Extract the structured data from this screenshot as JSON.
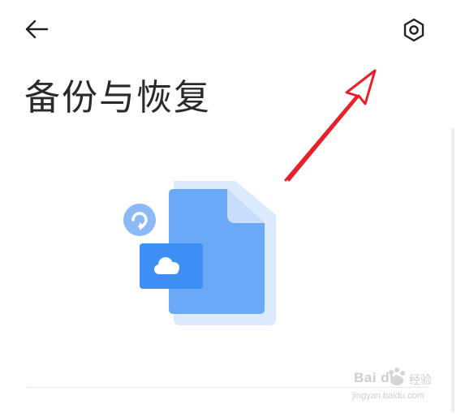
{
  "header": {
    "back_icon": "arrow-left-icon",
    "settings_icon": "gear-hexagon-icon",
    "title": "备份与恢复"
  },
  "illustration": {
    "icons": [
      "document-icon",
      "cloud-icon",
      "refresh-badge-icon"
    ],
    "colors": {
      "document": "#6aa9f8",
      "document_back": "#dbeaff",
      "cloud_card": "#3d8ff5",
      "badge": "#8cbaf7"
    }
  },
  "annotation": {
    "arrow_color": "#e8202a"
  },
  "watermark": {
    "brand": "Bai du",
    "subtitle": "经验",
    "url": "jingyan.baidu.com"
  }
}
